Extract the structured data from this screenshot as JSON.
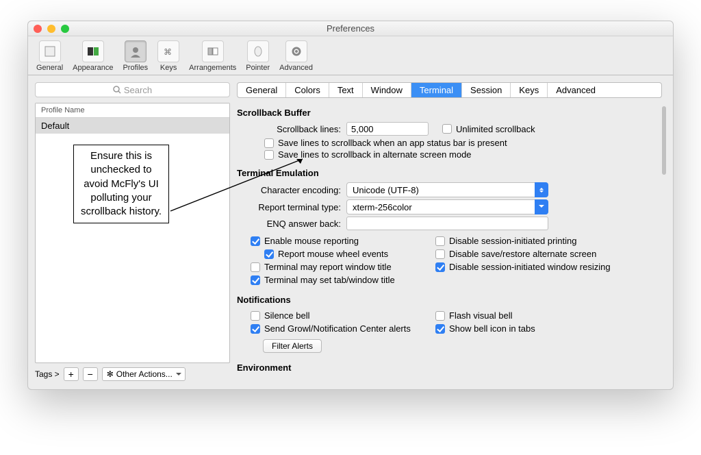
{
  "window_title": "Preferences",
  "toolbar": [
    {
      "id": "general",
      "label": "General"
    },
    {
      "id": "appearance",
      "label": "Appearance"
    },
    {
      "id": "profiles",
      "label": "Profiles",
      "active": true
    },
    {
      "id": "keys",
      "label": "Keys"
    },
    {
      "id": "arrangements",
      "label": "Arrangements"
    },
    {
      "id": "pointer",
      "label": "Pointer"
    },
    {
      "id": "advanced",
      "label": "Advanced"
    }
  ],
  "search_placeholder": "Search",
  "profile_header": "Profile Name",
  "profile_row": "Default",
  "annotation_text": "Ensure this is unchecked to avoid McFly's UI polluting your scrollback history.",
  "tags_label": "Tags >",
  "other_actions": "Other Actions...",
  "tabs": [
    "General",
    "Colors",
    "Text",
    "Window",
    "Terminal",
    "Session",
    "Keys",
    "Advanced"
  ],
  "active_tab": "Terminal",
  "scrollback": {
    "title": "Scrollback Buffer",
    "lines_label": "Scrollback lines:",
    "lines_value": "5,000",
    "unlimited": "Unlimited scrollback",
    "save_status": "Save lines to scrollback when an app status bar is present",
    "save_alt": "Save lines to scrollback in alternate screen mode"
  },
  "emulation": {
    "title": "Terminal Emulation",
    "enc_label": "Character encoding:",
    "enc_value": "Unicode (UTF-8)",
    "rep_label": "Report terminal type:",
    "rep_value": "xterm-256color",
    "enq_label": "ENQ answer back:",
    "mouse_reporting": "Enable mouse reporting",
    "mouse_wheel": "Report mouse wheel events",
    "report_title": "Terminal may report window title",
    "set_title": "Terminal may set tab/window title",
    "disable_print": "Disable session-initiated printing",
    "disable_save": "Disable save/restore alternate screen",
    "disable_resize": "Disable session-initiated window resizing"
  },
  "notifications": {
    "title": "Notifications",
    "silence": "Silence bell",
    "growl": "Send Growl/Notification Center alerts",
    "flash": "Flash visual bell",
    "show_bell": "Show bell icon in tabs",
    "filter": "Filter Alerts"
  },
  "environment_title": "Environment"
}
